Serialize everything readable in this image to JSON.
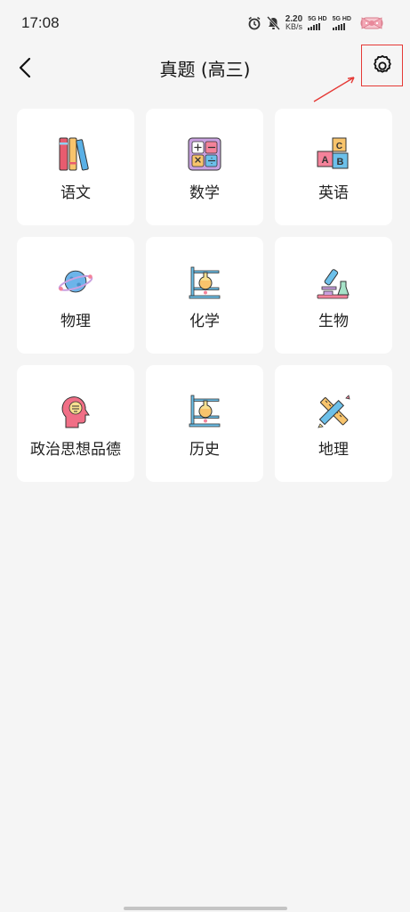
{
  "status_bar": {
    "time": "17:08",
    "net_speed_value": "2.20",
    "net_speed_unit": "KB/s",
    "sim1_label": "5G HD",
    "sim2_label": "5G HD"
  },
  "header": {
    "title": "真题 (高三)"
  },
  "subjects": [
    {
      "label": "语文",
      "icon": "books-icon"
    },
    {
      "label": "数学",
      "icon": "calculator-icon"
    },
    {
      "label": "英语",
      "icon": "abc-blocks-icon"
    },
    {
      "label": "物理",
      "icon": "planet-icon"
    },
    {
      "label": "化学",
      "icon": "flask-stand-icon"
    },
    {
      "label": "生物",
      "icon": "microscope-icon"
    },
    {
      "label": "政治思想品德",
      "icon": "head-brain-icon"
    },
    {
      "label": "历史",
      "icon": "flask-stand-icon"
    },
    {
      "label": "地理",
      "icon": "ruler-pencil-icon"
    }
  ],
  "colors": {
    "background": "#f5f5f5",
    "card": "#ffffff",
    "annotation_red": "#e53935"
  }
}
